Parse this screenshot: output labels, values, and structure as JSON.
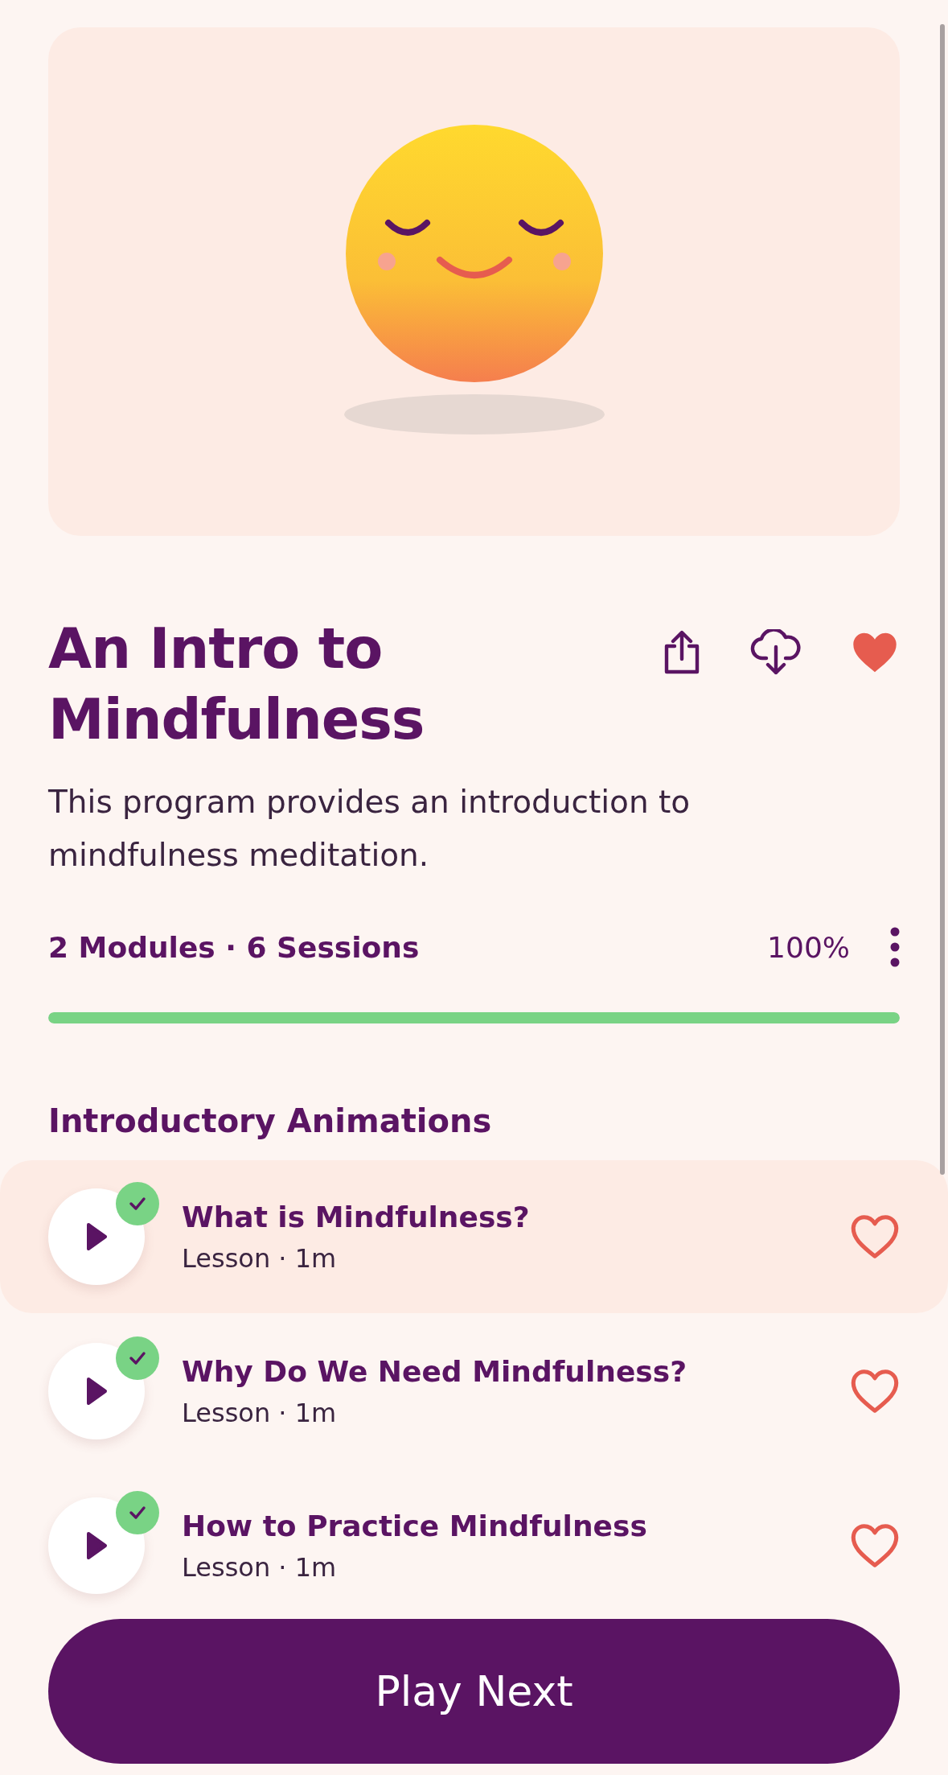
{
  "program": {
    "title": "An Intro to Mindfulness",
    "favorite": true,
    "description": "This program provides an introduction to mindfulness meditation.",
    "meta": "2 Modules · 6 Sessions",
    "percent": "100%",
    "level": 1
  },
  "section": {
    "title": "Introductory Animations",
    "lessons": [
      {
        "title": "What is Mindfulness?",
        "subtitle": "Lesson · 1m",
        "completed": true,
        "selected": true,
        "favorite": false
      },
      {
        "title": "Why Do We Need Mindfulness?",
        "subtitle": "Lesson · 1m",
        "completed": true,
        "selected": false,
        "favorite": false
      },
      {
        "title": "How to Practice Mindfulness",
        "subtitle": "Lesson · 1m",
        "completed": true,
        "selected": false,
        "favorite": false
      }
    ]
  },
  "button": {
    "label": "Play Next"
  }
}
